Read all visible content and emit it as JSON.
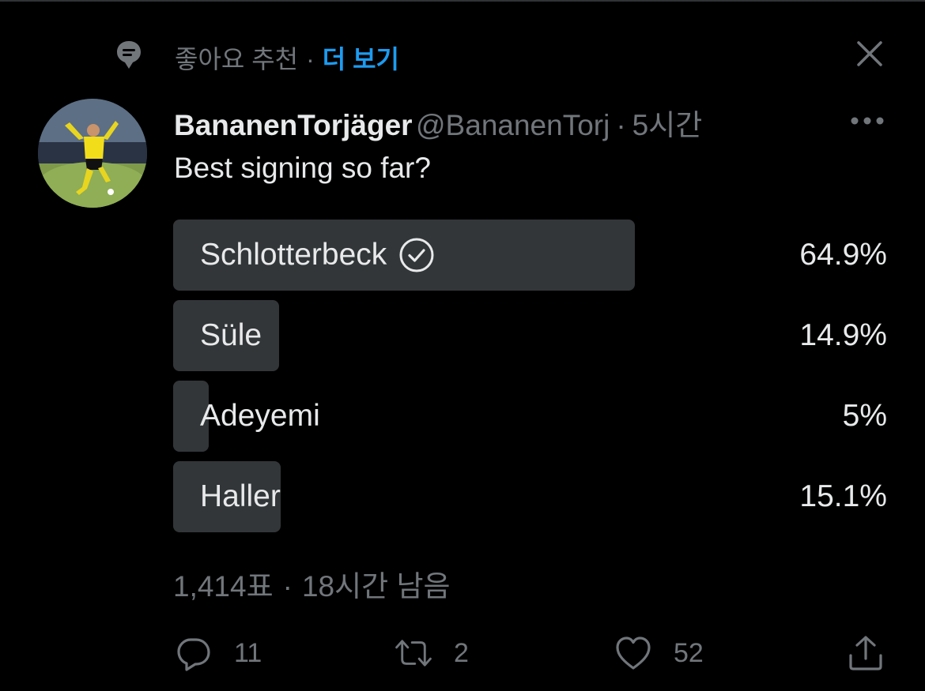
{
  "context": {
    "label": "좋아요 추천",
    "separator": "·",
    "more": "더 보기"
  },
  "tweet": {
    "display_name": "BananenTorjäger",
    "handle": "@BananenTorj",
    "separator": "·",
    "time": "5시간",
    "text": "Best signing so far?"
  },
  "poll": {
    "options": [
      {
        "label": "Schlotterbeck",
        "percent_text": "64.9%",
        "percent": 64.9,
        "winner": true
      },
      {
        "label": "Süle",
        "percent_text": "14.9%",
        "percent": 14.9,
        "winner": false
      },
      {
        "label": "Adeyemi",
        "percent_text": "5%",
        "percent": 5,
        "winner": false
      },
      {
        "label": "Haller",
        "percent_text": "15.1%",
        "percent": 15.1,
        "winner": false
      }
    ],
    "votes": "1,414표",
    "separator": "·",
    "remaining": "18시간 남음"
  },
  "actions": {
    "replies": "11",
    "retweets": "2",
    "likes": "52"
  },
  "colors": {
    "background": "#000000",
    "text_primary": "#e7e9ea",
    "text_secondary": "#71767b",
    "accent": "#1d9bf0",
    "poll_fill": "#333639"
  },
  "icons": [
    "topic-pin-icon",
    "close-icon",
    "more-dots-icon",
    "check-circle-icon",
    "reply-icon",
    "retweet-icon",
    "like-icon",
    "share-icon"
  ]
}
